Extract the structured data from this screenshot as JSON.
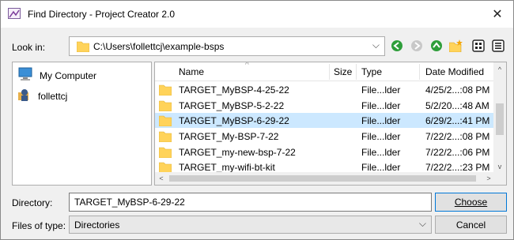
{
  "window": {
    "title": "Find Directory - Project Creator 2.0",
    "close_glyph": "✕"
  },
  "lookin": {
    "label": "Look in:",
    "path": "C:\\Users\\follettcj\\example-bsps",
    "icon": "folder-icon",
    "toolbar_icons": [
      "back-icon",
      "forward-icon",
      "up-folder-icon",
      "new-folder-icon",
      "list-view-icon",
      "detail-view-icon"
    ]
  },
  "sidebar": {
    "items": [
      {
        "label": "My Computer",
        "icon": "computer-icon"
      },
      {
        "label": "follettcj",
        "icon": "user-icon"
      }
    ]
  },
  "files": {
    "columns": [
      "Name",
      "Size",
      "Type",
      "Date Modified"
    ],
    "sort_indicator": "^",
    "rows": [
      {
        "name": "TARGET_MyBSP-4-25-22",
        "type": "File...lder",
        "date": "4/25/2...:08 PM"
      },
      {
        "name": "TARGET_MyBSP-5-2-22",
        "type": "File...lder",
        "date": "5/2/20...:48 AM"
      },
      {
        "name": "TARGET_MyBSP-6-29-22",
        "type": "File...lder",
        "date": "6/29/2...:41 PM",
        "selected": true
      },
      {
        "name": "TARGET_My-BSP-7-22",
        "type": "File...lder",
        "date": "7/22/2...:08 PM"
      },
      {
        "name": "TARGET_my-new-bsp-7-22",
        "type": "File...lder",
        "date": "7/22/2...:06 PM"
      },
      {
        "name": "TARGET_my-wifi-bt-kit",
        "type": "File...lder",
        "date": "7/22/2...:23 PM"
      }
    ],
    "scroll_glyphs": {
      "up": "^",
      "down": "v",
      "left": "<",
      "right": ">"
    }
  },
  "directory": {
    "label": "Directory:",
    "value": "TARGET_MyBSP-6-29-22",
    "choose_label": "Choose"
  },
  "filetype": {
    "label": "Files of type:",
    "value": "Directories",
    "cancel_label": "Cancel"
  },
  "colors": {
    "selection": "#cce8ff",
    "folder": "#ffd35a",
    "accent": "#0078d7",
    "nav_green": "#2e9e3a"
  }
}
